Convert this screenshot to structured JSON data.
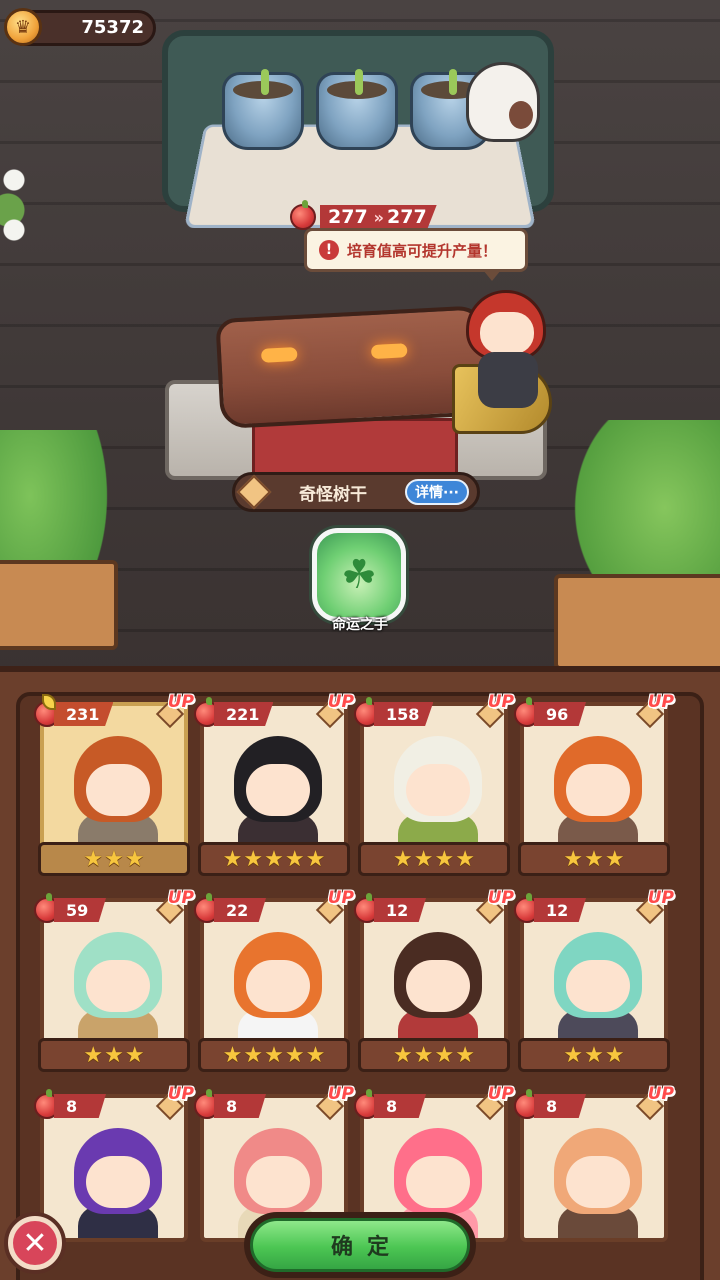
{
  "currency": {
    "icon": "crown-icon",
    "value": "75372"
  },
  "growth": {
    "current": "277",
    "next": "277",
    "arrow": "»"
  },
  "tip": {
    "text": "培育值高可提升产量！"
  },
  "item": {
    "name": "奇怪树干",
    "detail_label": "详情···"
  },
  "skill": {
    "name": "命运之手",
    "icon": "clover-icon"
  },
  "roster": [
    {
      "value": "231",
      "stars": 3,
      "up": "UP",
      "selected": true,
      "hair": "#c75a26",
      "body": "#8a7b6a"
    },
    {
      "value": "221",
      "stars": 5,
      "up": "UP",
      "selected": false,
      "hair": "#222024",
      "body": "#3b2f33"
    },
    {
      "value": "158",
      "stars": 4,
      "up": "UP",
      "selected": false,
      "hair": "#f1efe4",
      "body": "#8caa4a"
    },
    {
      "value": "96",
      "stars": 3,
      "up": "UP",
      "selected": false,
      "hair": "#e06a2a",
      "body": "#7a5a4a"
    },
    {
      "value": "59",
      "stars": 3,
      "up": "UP",
      "selected": false,
      "hair": "#9fe0c6",
      "body": "#c9a36a"
    },
    {
      "value": "22",
      "stars": 5,
      "up": "UP",
      "selected": false,
      "hair": "#e8742e",
      "body": "#f5f5f5"
    },
    {
      "value": "12",
      "stars": 4,
      "up": "UP",
      "selected": false,
      "hair": "#4a2c22",
      "body": "#b23a3a"
    },
    {
      "value": "12",
      "stars": 3,
      "up": "UP",
      "selected": false,
      "hair": "#7fd6c2",
      "body": "#4d4a5a"
    },
    {
      "value": "8",
      "stars": 0,
      "up": "UP",
      "selected": false,
      "hair": "#6a3ab0",
      "body": "#2f2f45"
    },
    {
      "value": "8",
      "stars": 0,
      "up": "UP",
      "selected": false,
      "hair": "#f08a88",
      "body": "#e8d9b8"
    },
    {
      "value": "8",
      "stars": 0,
      "up": "UP",
      "selected": false,
      "hair": "#ff6f8a",
      "body": "#ff9aa8"
    },
    {
      "value": "8",
      "stars": 0,
      "up": "UP",
      "selected": false,
      "hair": "#f0a878",
      "body": "#6a4a3a"
    }
  ],
  "buttons": {
    "confirm": "确定",
    "close": "✕"
  },
  "colors": {
    "accent_red": "#b33838",
    "confirm_green": "#4cc653",
    "star": "#f7c63e"
  }
}
